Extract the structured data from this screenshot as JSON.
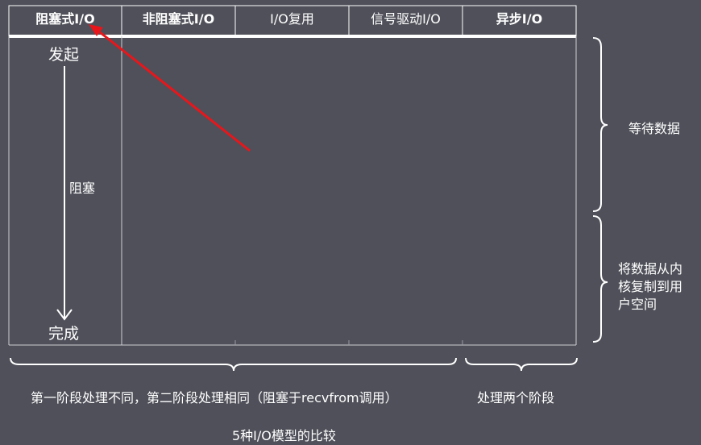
{
  "columns": [
    "阻塞式I/O",
    "非阻塞式I/O",
    "I/O复用",
    "信号驱动I/O",
    "异步I/O"
  ],
  "blocking_column": {
    "start_label": "发起",
    "blocked_label": "阻塞",
    "end_label": "完成"
  },
  "phases": {
    "wait_label": "等待数据",
    "copy_label": "将数据从内核复制到用户空间",
    "copy_lines": [
      "将数据从内",
      "核复制到用",
      "户空间"
    ]
  },
  "bottom": {
    "left_note": "第一阶段处理不同，第二阶段处理相同（阻塞于recvfrom调用）",
    "right_note": "处理两个阶段",
    "caption": "5种I/O模型的比较"
  },
  "colors": {
    "background": "#4f5059",
    "lines": "#ffffff",
    "annotation_arrow": "#e8161b"
  }
}
